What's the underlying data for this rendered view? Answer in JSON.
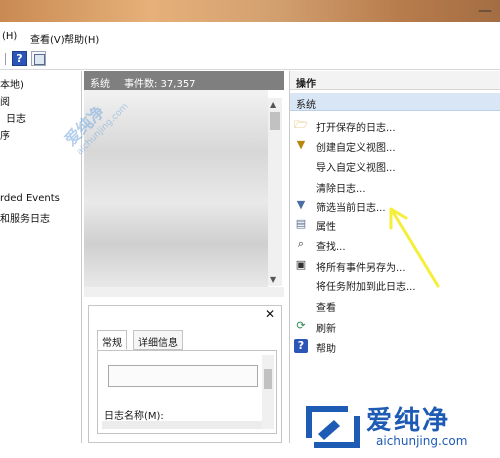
{
  "titlebar": {
    "close_glyph": "—"
  },
  "menu": {
    "items": [
      "(H)",
      "查看(V)",
      "帮助(H)"
    ]
  },
  "toolbar": {
    "help_icon": "help-icon",
    "help_glyph": "?",
    "view_icon": "view-icon"
  },
  "left_tree": {
    "items": [
      "本地)",
      "阅",
      "日志",
      "序",
      "rded Events",
      "和服务日志"
    ]
  },
  "events_panel": {
    "name": "系统",
    "count_label": "事件数: 37,357"
  },
  "detail_pane": {
    "close_glyph": "✕",
    "tabs": [
      "常规",
      "详细信息"
    ],
    "log_name_label": "日志名称(M):"
  },
  "actions_panel": {
    "header": "操作",
    "section": "系统",
    "items": [
      {
        "icon": "folder-open-icon",
        "label": "打开保存的日志..."
      },
      {
        "icon": "filter-icon",
        "label": "创建自定义视图..."
      },
      {
        "icon": "",
        "label": "导入自定义视图..."
      },
      {
        "icon": "",
        "label": "清除日志..."
      },
      {
        "icon": "filter-icon",
        "label": "筛选当前日志..."
      },
      {
        "icon": "properties-icon",
        "label": "属性"
      },
      {
        "icon": "find-icon",
        "label": "查找..."
      },
      {
        "icon": "save-icon",
        "label": "将所有事件另存为..."
      },
      {
        "icon": "",
        "label": "将任务附加到此日志..."
      },
      {
        "icon": "",
        "label": "查看"
      },
      {
        "icon": "refresh-icon",
        "label": "刷新"
      },
      {
        "icon": "help-icon",
        "label": "帮助"
      }
    ]
  },
  "watermark": {
    "text": "爱纯净",
    "url": "aichunjing.com"
  },
  "logo": {
    "brand": "爱纯净",
    "url": "aichunjing.com",
    "color": "#1e5bb5"
  },
  "annotation": {
    "color": "#f5ee3a"
  }
}
